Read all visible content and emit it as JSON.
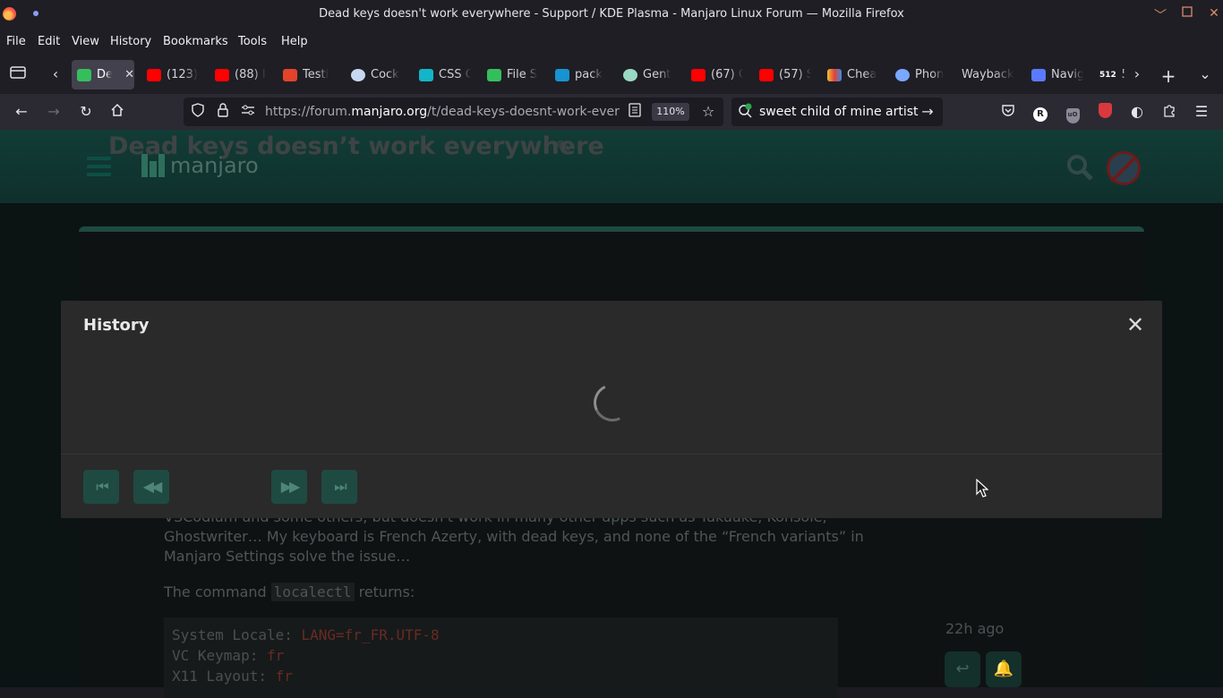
{
  "window": {
    "title": "Dead keys doesn't work everywhere - Support / KDE Plasma - Manjaro Linux Forum — Mozilla Firefox"
  },
  "menu": [
    "File",
    "Edit",
    "View",
    "History",
    "Bookmarks",
    "Tools",
    "Help"
  ],
  "tabs": [
    {
      "label": "De",
      "icon": "manjaro-favicon",
      "color": "#35bf5c",
      "active": true
    },
    {
      "label": "(123)",
      "icon": "youtube-favicon",
      "color": "#ff0000"
    },
    {
      "label": "(88) I",
      "icon": "youtube-favicon",
      "color": "#ff0000"
    },
    {
      "label": "Testi",
      "icon": "gitlab-favicon",
      "color": "#e2432a"
    },
    {
      "label": "Cock",
      "icon": "cockpit-favicon",
      "color": "#c8d7f0"
    },
    {
      "label": "CSS C",
      "icon": "css-favicon",
      "color": "#13b5c8"
    },
    {
      "label": "File S",
      "icon": "manjaro-favicon",
      "color": "#35bf5c"
    },
    {
      "label": "pack",
      "icon": "arch-favicon",
      "color": "#1793d1"
    },
    {
      "label": "Gent",
      "icon": "gentoo-favicon",
      "color": "#9ad8c4"
    },
    {
      "label": "(67) C",
      "icon": "youtube-favicon",
      "color": "#ff0000"
    },
    {
      "label": "(57) S",
      "icon": "youtube-favicon",
      "color": "#ff0000"
    },
    {
      "label": "Chea",
      "icon": "colors-favicon",
      "color": "#f2c230"
    },
    {
      "label": "Phon",
      "icon": "phone-favicon",
      "color": "#7aa7ff"
    },
    {
      "label": "Wayback",
      "icon": "",
      "color": ""
    },
    {
      "label": "Navig",
      "icon": "nav-favicon",
      "color": "#5a7bff"
    },
    {
      "label": "5",
      "icon": "512-favicon",
      "color": "#ffffff"
    }
  ],
  "tab_512_badge": "512",
  "nav": {
    "url_prefix": "https://forum.",
    "url_domain": "manjaro.org",
    "url_path": "/t/dead-keys-doesnt-work-everywhere",
    "zoom": "110%",
    "search_query": "sweet child of mine artist",
    "profile_letter": "R",
    "ublock_label": "uO"
  },
  "forum": {
    "logo_text": "manjaro",
    "topic_title": "Dead keys doesn’t work everywhere",
    "post_line_1": "VSCodium and some others, but doesn't work in many other apps such as Yakuake, Konsole,",
    "post_line_2": "Ghostwriter… My keyboard is French Azerty, with dead keys, and none of the “French variants” in",
    "post_line_3": "Manjaro Settings solve the issue…",
    "command_prefix": "The command ",
    "command": "localectl",
    "command_suffix": " returns:",
    "code": [
      {
        "key": "System Locale: ",
        "value": "LANG=fr_FR.UTF-8"
      },
      {
        "key": "VC Keymap: ",
        "value": "fr"
      },
      {
        "key": "X11 Layout: ",
        "value": "fr"
      }
    ],
    "time_ago": "22h ago"
  },
  "modal": {
    "title": "History",
    "close": "✕",
    "buttons": [
      "first-revision",
      "previous-revision",
      "next-revision",
      "last-revision"
    ]
  }
}
